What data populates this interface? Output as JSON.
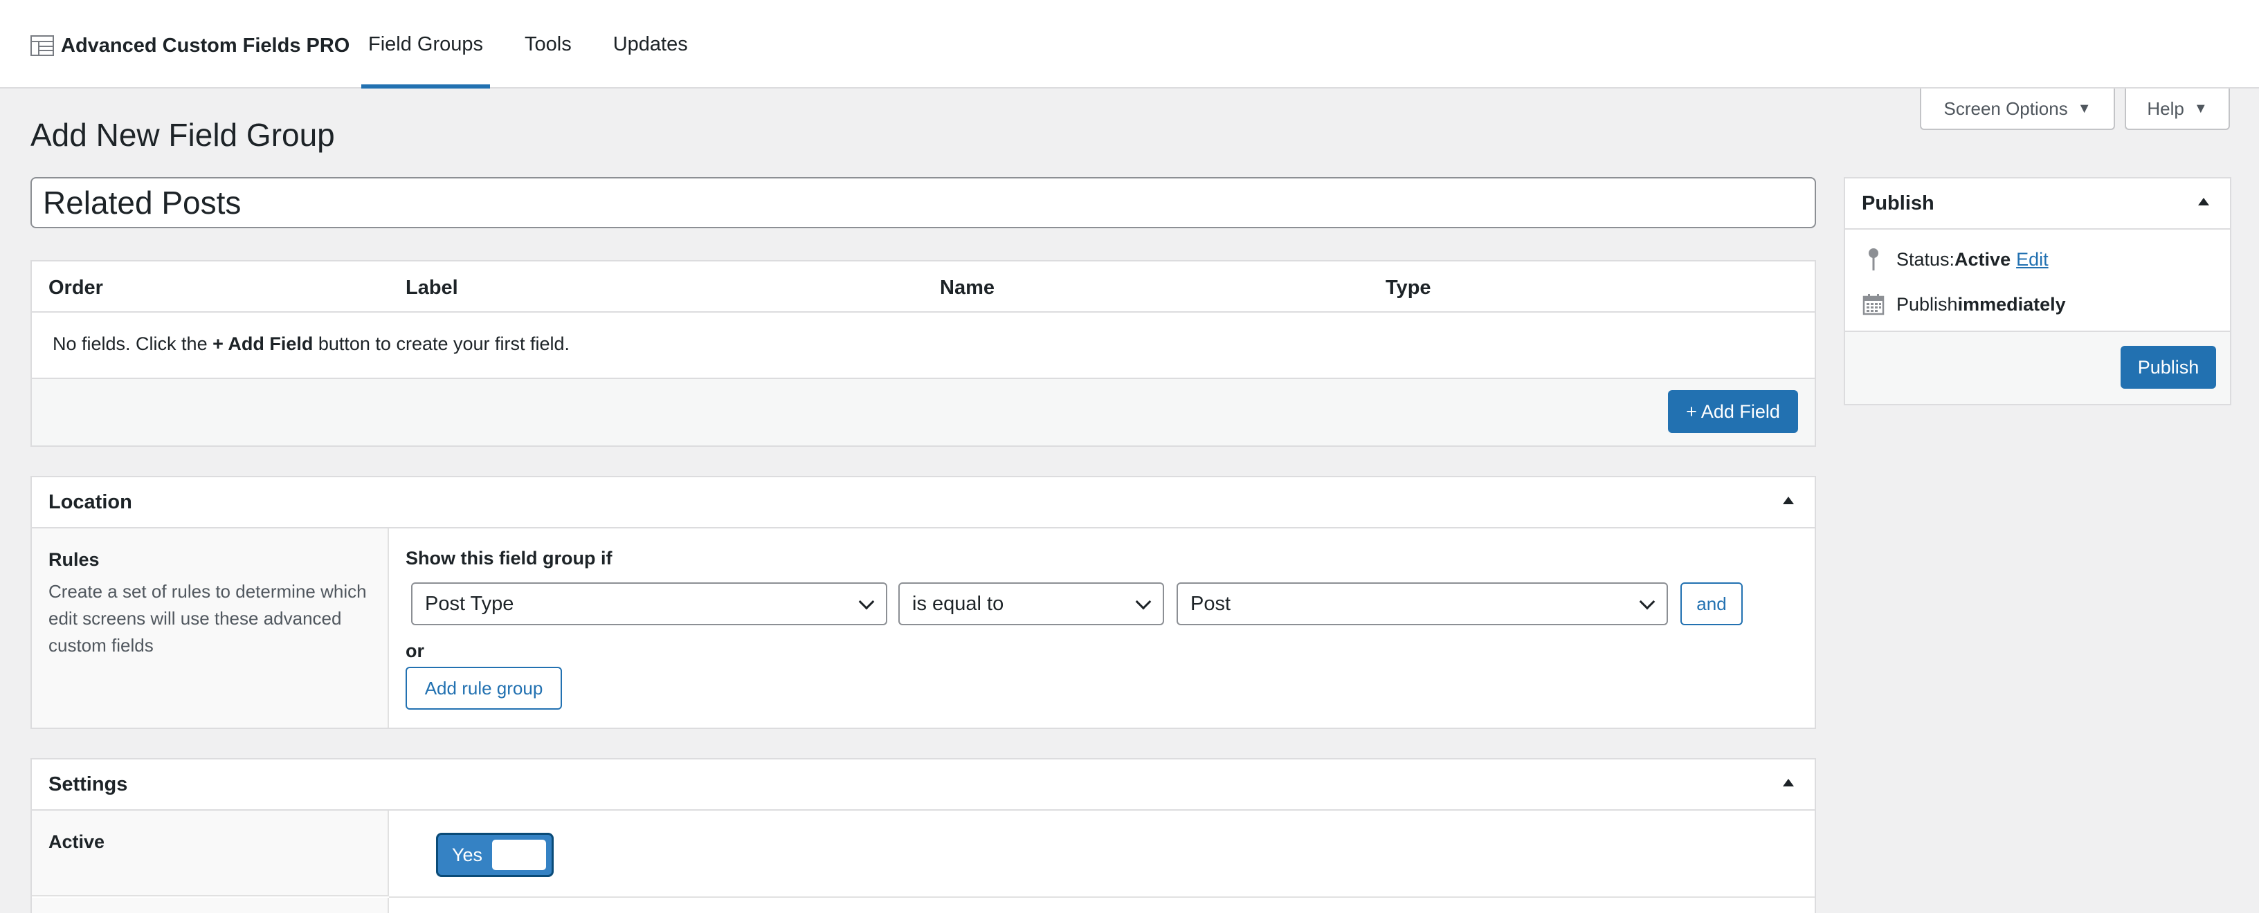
{
  "brand": {
    "name": "Advanced Custom Fields PRO"
  },
  "nav": {
    "items": [
      "Field Groups",
      "Tools",
      "Updates"
    ],
    "active": 0
  },
  "screen_tabs": {
    "screen_options": "Screen Options",
    "help": "Help"
  },
  "page": {
    "title": "Add New Field Group",
    "group_title_value": "Related Posts"
  },
  "fields": {
    "columns": [
      "Order",
      "Label",
      "Name",
      "Type"
    ],
    "empty_prefix": "No fields. Click the ",
    "empty_strong": "+ Add Field",
    "empty_suffix": " button to create your first field.",
    "add_button": "+ Add Field"
  },
  "location": {
    "title": "Location",
    "rules_title": "Rules",
    "rules_desc": "Create a set of rules to determine which edit screens will use these advanced custom fields",
    "show_if": "Show this field group if",
    "param": "Post Type",
    "operator": "is equal to",
    "value": "Post",
    "and_button": "and",
    "or_label": "or",
    "add_group_button": "Add rule group"
  },
  "settings": {
    "title": "Settings",
    "active_label": "Active",
    "toggle_label": "Yes"
  },
  "publish": {
    "title": "Publish",
    "status_label": "Status: ",
    "status_value": "Active",
    "edit_link": "Edit",
    "publish_label": "Publish ",
    "publish_value": "immediately",
    "publish_button": "Publish"
  },
  "colors": {
    "accent": "#2271b1",
    "background": "#f0f0f1"
  },
  "icons": {
    "brand": "table-icon",
    "status": "pin-icon",
    "schedule": "calendar-icon",
    "caret": "caret-down-icon",
    "collapse": "triangle-up-icon"
  }
}
